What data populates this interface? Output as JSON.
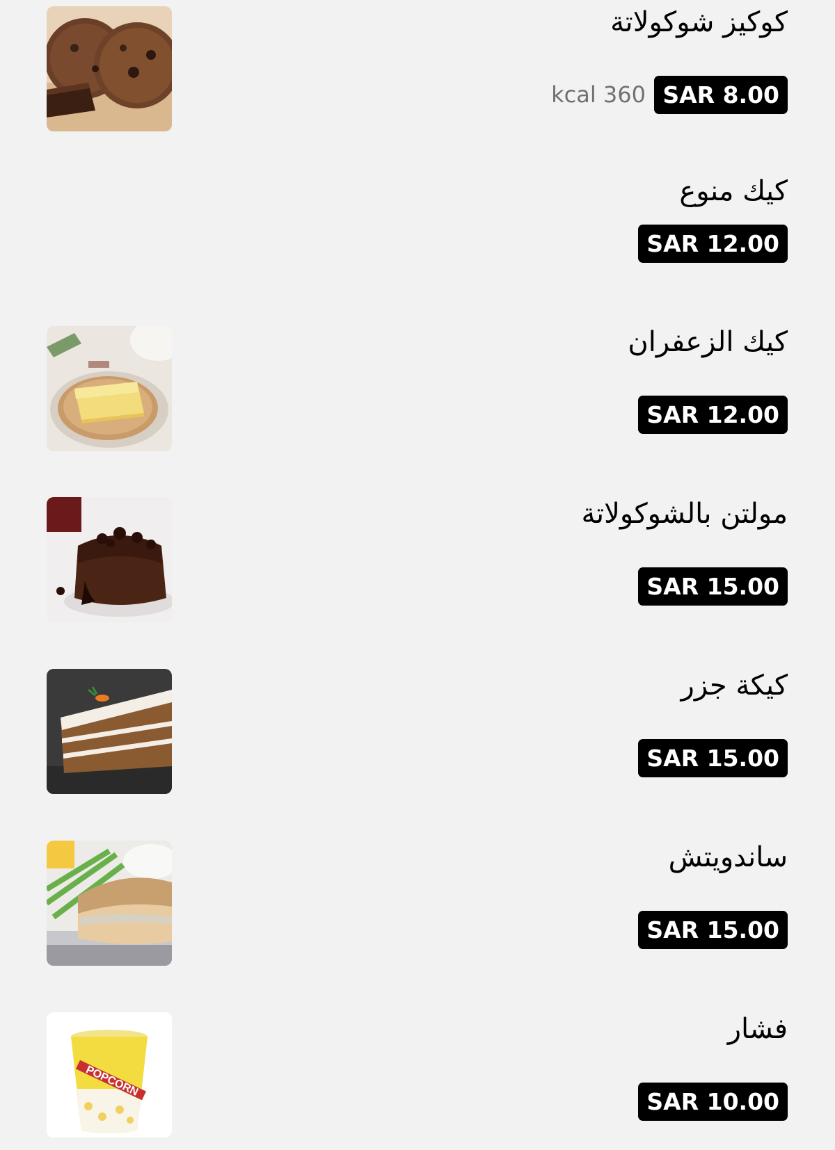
{
  "currency_note": "",
  "items": [
    {
      "name": "كوكيز شوكولاتة",
      "price": "SAR 8.00",
      "kcal": "kcal 360",
      "image": "chocolate-cookies-photo"
    },
    {
      "name": "كيك منوع",
      "price": "SAR 12.00",
      "image": ""
    },
    {
      "name": "كيك الزعفران",
      "price": "SAR 12.00",
      "image": "saffron-cake-photo"
    },
    {
      "name": "مولتن بالشوكولاتة",
      "price": "SAR 15.00",
      "image": "chocolate-molten-cake-photo"
    },
    {
      "name": "كيكة جزر",
      "price": "SAR 15.00",
      "image": "carrot-cake-photo"
    },
    {
      "name": "ساندويتش",
      "price": "SAR 15.00",
      "image": "sandwich-photo"
    },
    {
      "name": "فشار",
      "price": "SAR 10.00",
      "image": "popcorn-cup-photo",
      "image_text": "POPCORN"
    }
  ]
}
